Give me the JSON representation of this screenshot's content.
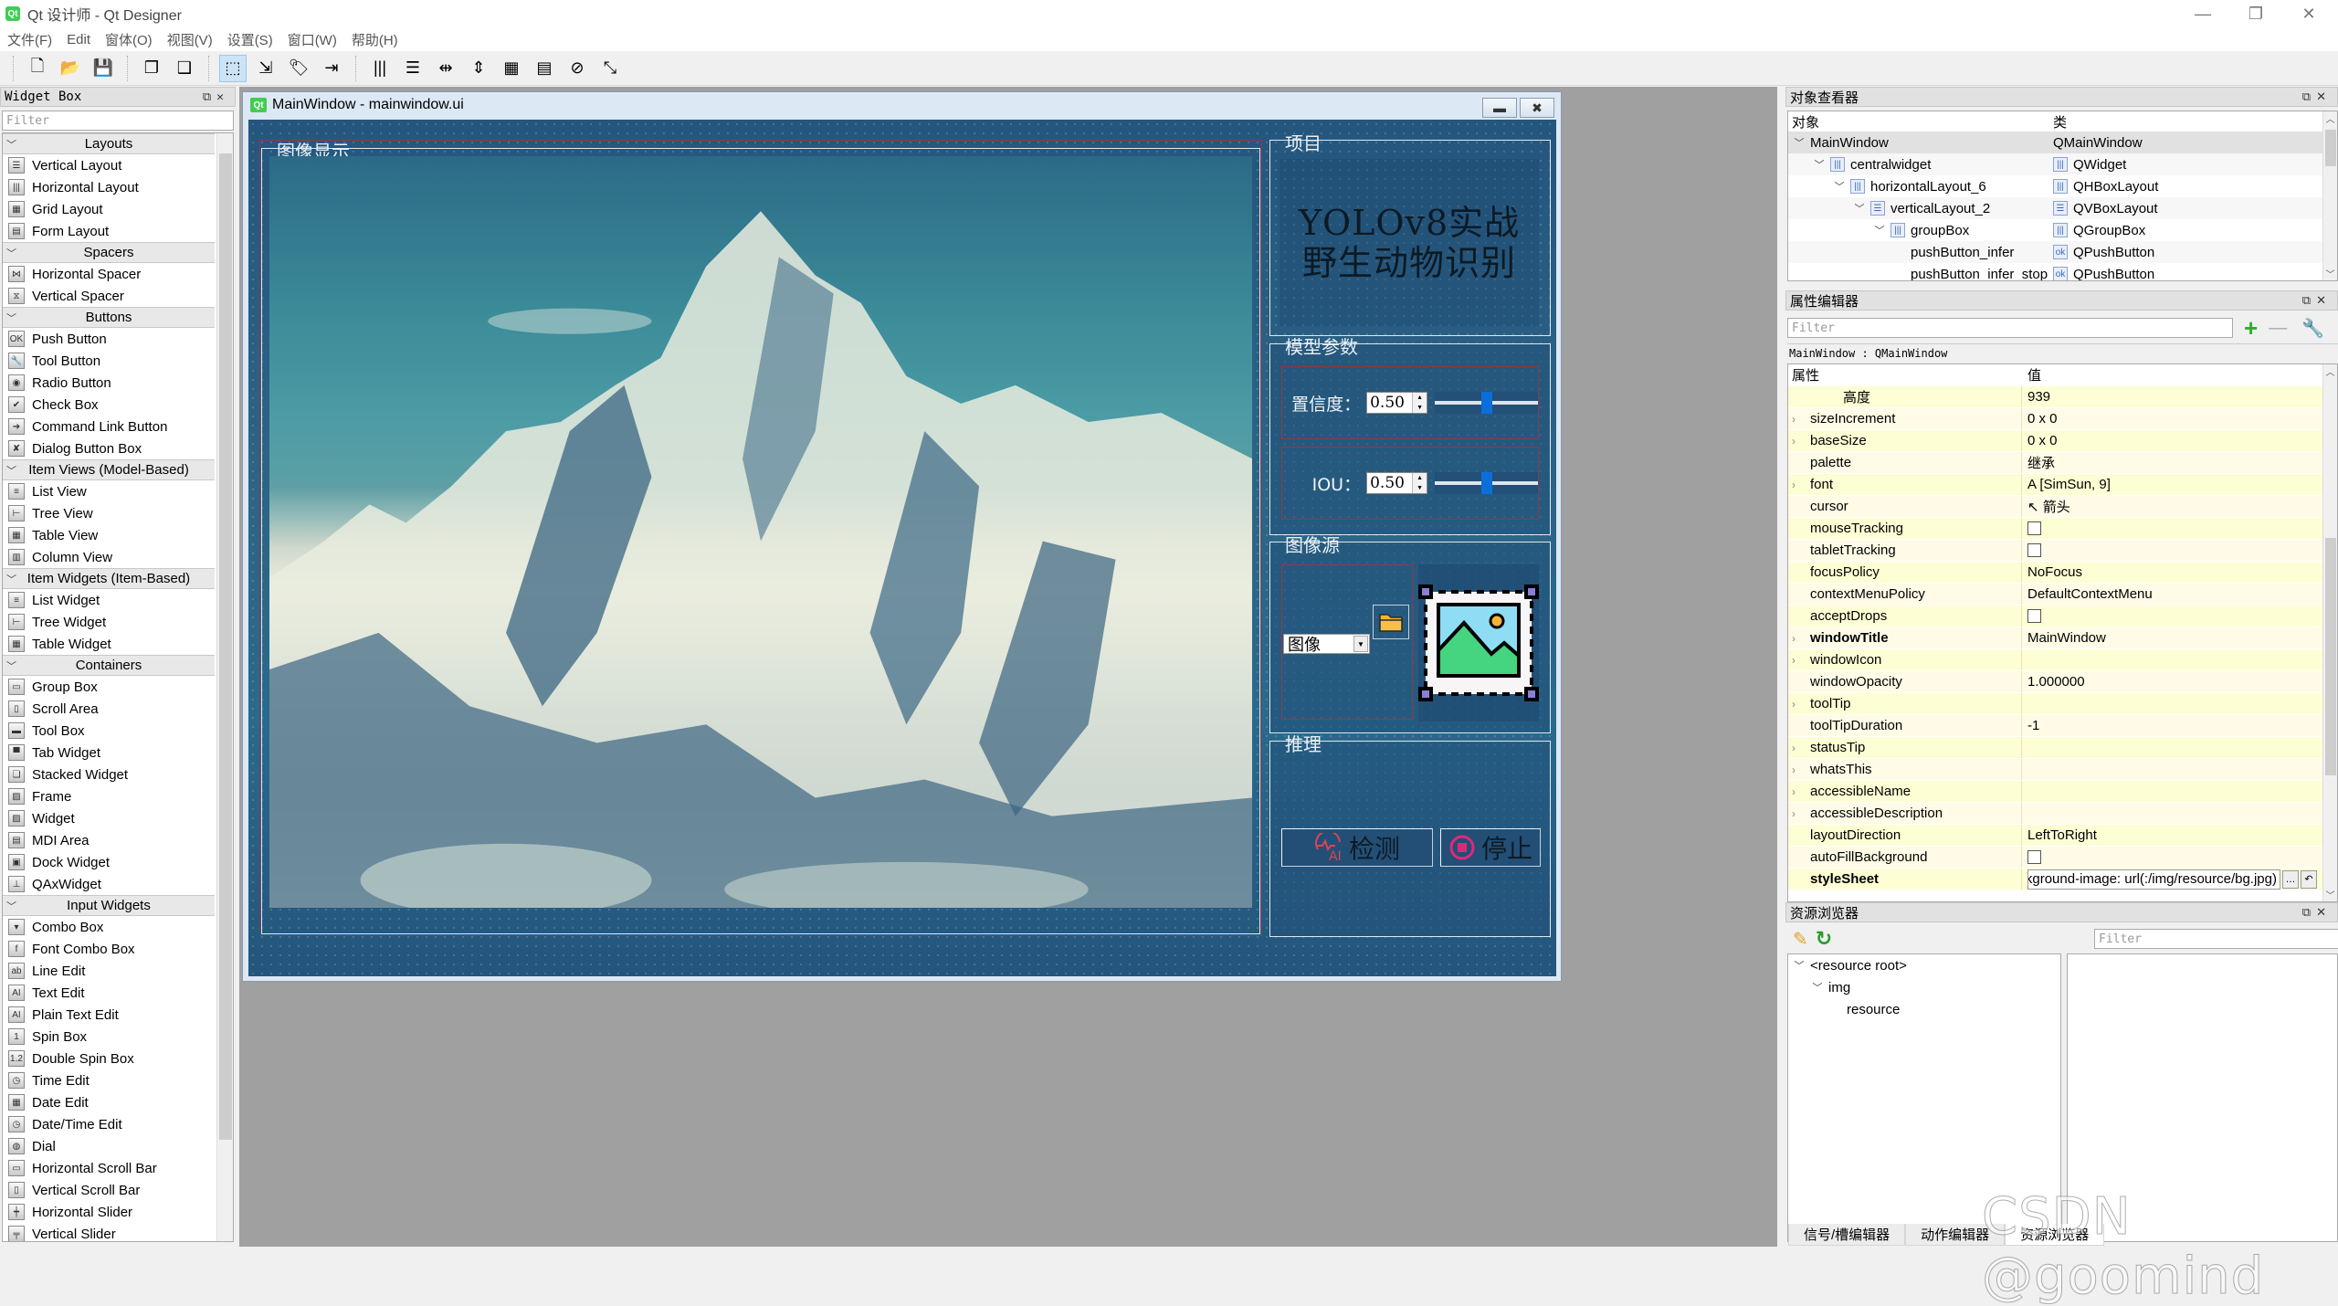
{
  "app": {
    "title": "Qt 设计师 - Qt Designer",
    "window_controls": {
      "minimize": "—",
      "restore": "❐",
      "close": "✕"
    }
  },
  "menubar": [
    "文件(F)",
    "Edit",
    "窗体(O)",
    "视图(V)",
    "设置(S)",
    "窗口(W)",
    "帮助(H)"
  ],
  "toolbar": {
    "groups": [
      [
        {
          "icon": "new-file-icon",
          "glyph": "🗋"
        },
        {
          "icon": "open-folder-icon",
          "glyph": "📂"
        },
        {
          "icon": "save-icon",
          "glyph": "💾"
        }
      ],
      [
        {
          "icon": "send-to-back-icon",
          "glyph": "❐"
        },
        {
          "icon": "bring-to-front-icon",
          "glyph": "❑"
        }
      ],
      [
        {
          "icon": "edit-widgets-icon",
          "glyph": "⬚",
          "active": true
        },
        {
          "icon": "edit-signals-slots-icon",
          "glyph": "⇲"
        },
        {
          "icon": "edit-buddies-icon",
          "glyph": "🏷"
        },
        {
          "icon": "edit-tab-order-icon",
          "glyph": "⇥"
        }
      ],
      [
        {
          "icon": "layout-horizontal-icon",
          "glyph": "|||"
        },
        {
          "icon": "layout-vertical-icon",
          "glyph": "☰"
        },
        {
          "icon": "layout-h-splitter-icon",
          "glyph": "⇹"
        },
        {
          "icon": "layout-v-splitter-icon",
          "glyph": "⇕"
        },
        {
          "icon": "layout-grid-icon",
          "glyph": "▦"
        },
        {
          "icon": "layout-form-icon",
          "glyph": "▤"
        },
        {
          "icon": "break-layout-icon",
          "glyph": "⊘"
        },
        {
          "icon": "adjust-size-icon",
          "glyph": "⤡"
        }
      ]
    ]
  },
  "widget_box": {
    "title": "Widget Box",
    "filter_placeholder": "Filter",
    "categories": [
      {
        "name": "Layouts",
        "items": [
          [
            "Vertical Layout",
            "☰"
          ],
          [
            "Horizontal Layout",
            "|||"
          ],
          [
            "Grid Layout",
            "▦"
          ],
          [
            "Form Layout",
            "▤"
          ]
        ]
      },
      {
        "name": "Spacers",
        "items": [
          [
            "Horizontal Spacer",
            "⋈"
          ],
          [
            "Vertical Spacer",
            "⧖"
          ]
        ]
      },
      {
        "name": "Buttons",
        "items": [
          [
            "Push Button",
            "OK"
          ],
          [
            "Tool Button",
            "🔧"
          ],
          [
            "Radio Button",
            "◉"
          ],
          [
            "Check Box",
            "✔"
          ],
          [
            "Command Link Button",
            "➔"
          ],
          [
            "Dialog Button Box",
            "✘"
          ]
        ]
      },
      {
        "name": "Item Views (Model-Based)",
        "items": [
          [
            "List View",
            "≡"
          ],
          [
            "Tree View",
            "⊢"
          ],
          [
            "Table View",
            "▦"
          ],
          [
            "Column View",
            "▥"
          ]
        ]
      },
      {
        "name": "Item Widgets (Item-Based)",
        "items": [
          [
            "List Widget",
            "≡"
          ],
          [
            "Tree Widget",
            "⊢"
          ],
          [
            "Table Widget",
            "▦"
          ]
        ]
      },
      {
        "name": "Containers",
        "items": [
          [
            "Group Box",
            "▭"
          ],
          [
            "Scroll Area",
            "▯"
          ],
          [
            "Tool Box",
            "▬"
          ],
          [
            "Tab Widget",
            "▀"
          ],
          [
            "Stacked Widget",
            "❏"
          ],
          [
            "Frame",
            "▨"
          ],
          [
            "Widget",
            "▨"
          ],
          [
            "MDI Area",
            "▤"
          ],
          [
            "Dock Widget",
            "▣"
          ],
          [
            "QAxWidget",
            "⊥"
          ]
        ]
      },
      {
        "name": "Input Widgets",
        "items": [
          [
            "Combo Box",
            "▾"
          ],
          [
            "Font Combo Box",
            "f"
          ],
          [
            "Line Edit",
            "ab"
          ],
          [
            "Text Edit",
            "AI"
          ],
          [
            "Plain Text Edit",
            "AI"
          ],
          [
            "Spin Box",
            "1"
          ],
          [
            "Double Spin Box",
            "1.2"
          ],
          [
            "Time Edit",
            "◷"
          ],
          [
            "Date Edit",
            "▦"
          ],
          [
            "Date/Time Edit",
            "◷"
          ],
          [
            "Dial",
            "◍"
          ],
          [
            "Horizontal Scroll Bar",
            "▭"
          ],
          [
            "Vertical Scroll Bar",
            "▯"
          ],
          [
            "Horizontal Slider",
            "┿"
          ],
          [
            "Vertical Slider",
            "╤"
          ]
        ]
      }
    ]
  },
  "form": {
    "window_title": "MainWindow - mainwindow.ui",
    "image_group_title": "图像显示",
    "project_group_title": "项目",
    "project_line1": "YOLOv8实战",
    "project_line2": "野生动物识别",
    "params_group_title": "模型参数",
    "confidence": {
      "label": "置信度：",
      "value": "0.50",
      "slider_fraction": 0.5
    },
    "iou": {
      "label": "IOU：",
      "value": "0.50",
      "slider_fraction": 0.5
    },
    "source_group_title": "图像源",
    "source_combo_value": "图像",
    "infer_group_title": "推理",
    "detect_button": "检测",
    "stop_button": "停止",
    "colors": {
      "canvas_bg": "#285d83",
      "slider_handle": "#0a6fd8",
      "layout_frame": "#8c3b4a",
      "detect_icon": "#d94455",
      "stop_icon": "#e0287a",
      "folder_icon": "#f5b335",
      "picture_sky": "#8fdcf5",
      "picture_mountain": "#45d480"
    }
  },
  "object_inspector": {
    "title": "对象查看器",
    "columns": [
      "对象",
      "类"
    ],
    "rows": [
      {
        "name": "MainWindow",
        "cls": "QMainWindow",
        "depth": 0,
        "expanded": true,
        "selected": true
      },
      {
        "name": "centralwidget",
        "cls": "QWidget",
        "depth": 1,
        "expanded": true
      },
      {
        "name": "horizontalLayout_6",
        "cls": "QHBoxLayout",
        "depth": 2,
        "expanded": true
      },
      {
        "name": "verticalLayout_2",
        "cls": "QVBoxLayout",
        "depth": 3,
        "expanded": true
      },
      {
        "name": "groupBox",
        "cls": "QGroupBox",
        "depth": 4,
        "expanded": true
      },
      {
        "name": "pushButton_infer",
        "cls": "QPushButton",
        "depth": 5
      },
      {
        "name": "pushButton_infer_stop",
        "cls": "QPushButton",
        "depth": 5
      }
    ]
  },
  "property_editor": {
    "title": "属性编辑器",
    "filter_placeholder": "Filter",
    "object_label": "MainWindow : QMainWindow",
    "columns": [
      "属性",
      "值"
    ],
    "rows": [
      {
        "name": "高度",
        "value": "939",
        "indent": true
      },
      {
        "name": "sizeIncrement",
        "value": "0 x 0",
        "expandable": true
      },
      {
        "name": "baseSize",
        "value": "0 x 0",
        "expandable": true
      },
      {
        "name": "palette",
        "value": "继承"
      },
      {
        "name": "font",
        "value": "A  [SimSun, 9]",
        "expandable": true
      },
      {
        "name": "cursor",
        "value": "↖  箭头"
      },
      {
        "name": "mouseTracking",
        "checkbox": false
      },
      {
        "name": "tabletTracking",
        "checkbox": false
      },
      {
        "name": "focusPolicy",
        "value": "NoFocus"
      },
      {
        "name": "contextMenuPolicy",
        "value": "DefaultContextMenu"
      },
      {
        "name": "acceptDrops",
        "checkbox": false
      },
      {
        "name": "windowTitle",
        "value": "MainWindow",
        "expandable": true,
        "bold": true
      },
      {
        "name": "windowIcon",
        "value": "",
        "expandable": true
      },
      {
        "name": "windowOpacity",
        "value": "1.000000"
      },
      {
        "name": "toolTip",
        "value": "",
        "expandable": true
      },
      {
        "name": "toolTipDuration",
        "value": "-1"
      },
      {
        "name": "statusTip",
        "value": "",
        "expandable": true
      },
      {
        "name": "whatsThis",
        "value": "",
        "expandable": true
      },
      {
        "name": "accessibleName",
        "value": "",
        "expandable": true
      },
      {
        "name": "accessibleDescription",
        "value": "",
        "expandable": true
      },
      {
        "name": "layoutDirection",
        "value": "LeftToRight"
      },
      {
        "name": "autoFillBackground",
        "checkbox": false
      },
      {
        "name": "styleSheet",
        "stylesheet": "background-image: url(:/img/resource/bg.jpg);",
        "bold": true
      }
    ]
  },
  "resource_browser": {
    "title": "资源浏览器",
    "filter_placeholder": "Filter",
    "tree": [
      {
        "label": "<resource root>",
        "depth": 0,
        "expanded": true
      },
      {
        "label": "img",
        "depth": 1,
        "expanded": true
      },
      {
        "label": "resource",
        "depth": 2
      }
    ]
  },
  "bottom_tabs": [
    {
      "label": "信号/槽编辑器",
      "active": false
    },
    {
      "label": "动作编辑器",
      "active": false
    },
    {
      "label": "资源浏览器",
      "active": true
    }
  ],
  "watermark": "CSDN @goomind"
}
